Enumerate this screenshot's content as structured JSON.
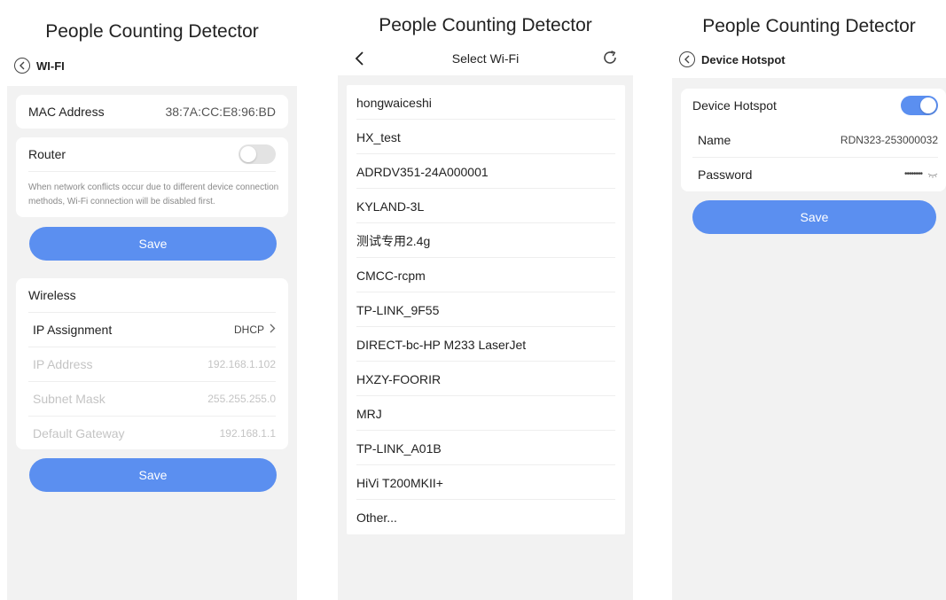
{
  "app_title": "People Counting Detector",
  "wifi_screen": {
    "nav_label": "WI-FI",
    "mac": {
      "label": "MAC Address",
      "value": "38:7A:CC:E8:96:BD"
    },
    "router": {
      "label": "Router",
      "toggle_on": false,
      "note": "When network conflicts occur due to different device connection methods, Wi-Fi connection will be disabled first.",
      "save_label": "Save"
    },
    "wireless": {
      "header": "Wireless",
      "ip_assignment": {
        "label": "IP Assignment",
        "value": "DHCP"
      },
      "ip_address": {
        "label": "IP Address",
        "value": "192.168.1.102"
      },
      "subnet_mask": {
        "label": "Subnet Mask",
        "value": "255.255.255.0"
      },
      "default_gateway": {
        "label": "Default Gateway",
        "value": "192.168.1.1"
      },
      "save_label": "Save"
    }
  },
  "select_wifi_screen": {
    "title": "Select Wi-Fi",
    "networks": [
      "hongwaiceshi",
      "HX_test",
      "ADRDV351-24A000001",
      "KYLAND-3L",
      "测试专用2.4g",
      "CMCC-rcpm",
      "TP-LINK_9F55",
      "DIRECT-bc-HP M233 LaserJet",
      "HXZY-FOORIR",
      "MRJ",
      "TP-LINK_A01B",
      "HiVi T200MKII+",
      "Other..."
    ]
  },
  "hotspot_screen": {
    "nav_label": "Device Hotspot",
    "hotspot": {
      "label": "Device Hotspot",
      "toggle_on": true
    },
    "name": {
      "label": "Name",
      "value": "RDN323-253000032"
    },
    "password": {
      "label": "Password",
      "value": "••••••••"
    },
    "save_label": "Save"
  },
  "icons": {
    "back": "back-circle-icon",
    "back_plain": "back-chevron-icon",
    "refresh": "refresh-icon",
    "chevron": "chevron-right-icon",
    "eye_closed": "eye-closed-icon"
  },
  "colors": {
    "accent": "#5b8ff0",
    "page_bg": "#f2f2f2",
    "card_bg": "#ffffff",
    "disabled_text": "#c4c4c4"
  }
}
